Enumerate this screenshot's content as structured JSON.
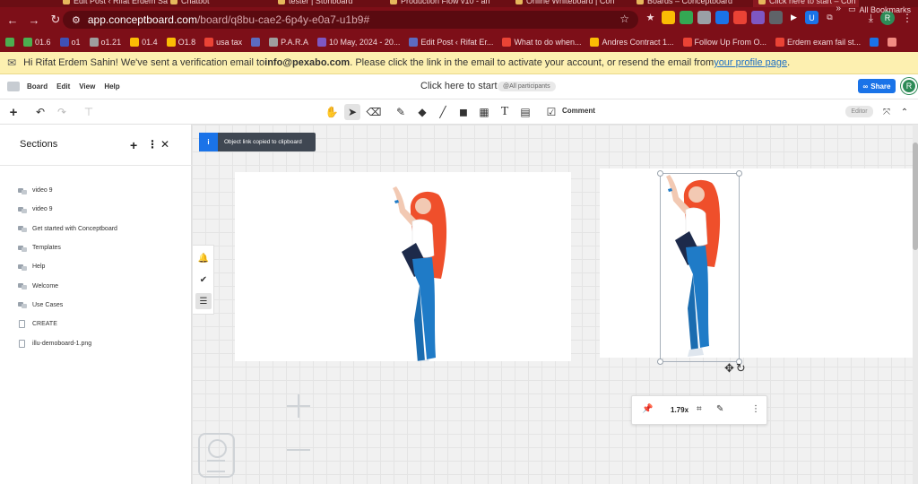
{
  "browser": {
    "tabs": [
      {
        "label": "Edit Post ‹ Rifat Erdem Sa",
        "active": false
      },
      {
        "label": "Chatbot",
        "active": false
      },
      {
        "label": "tester | Storiboard",
        "active": false
      },
      {
        "label": "Production Flow v10 - an",
        "active": false
      },
      {
        "label": "Online Whiteboard | Con",
        "active": false
      },
      {
        "label": "Boards – Conceptboard",
        "active": false
      },
      {
        "label": "Click here to start – Con",
        "active": true
      }
    ],
    "url_host": "app.conceptboard.com",
    "url_path": "/board/q8bu-cae2-6p4y-e0a7-u1b9#",
    "profile_initial": "R",
    "bookmarks": [
      {
        "label": "",
        "color": "#4caf50"
      },
      {
        "label": "01.6",
        "color": "#4caf50"
      },
      {
        "label": "o1",
        "color": "#3f51b5"
      },
      {
        "label": "o1.21",
        "color": "#9e9e9e"
      },
      {
        "label": "01.4",
        "color": "#fbbc04"
      },
      {
        "label": "O1.8",
        "color": "#fbbc04"
      },
      {
        "label": "usa tax",
        "color": "#ea4335"
      },
      {
        "label": "",
        "color": "#5c6bc0"
      },
      {
        "label": "P.A.R.A",
        "color": "#9e9e9e"
      },
      {
        "label": "10 May, 2024 - 20...",
        "color": "#7e57c2"
      },
      {
        "label": "Edit Post ‹ Rifat Er...",
        "color": "#5c6bc0"
      },
      {
        "label": "What to do when...",
        "color": "#ea4335"
      },
      {
        "label": "Andres Contract 1...",
        "color": "#fbbc04"
      },
      {
        "label": "Follow Up From O...",
        "color": "#ea4335"
      },
      {
        "label": "Erdem exam fail st...",
        "color": "#ea4335"
      },
      {
        "label": "",
        "color": "#1a73e8"
      },
      {
        "label": "",
        "color": "#f28b82"
      }
    ],
    "all_bookmarks": "All Bookmarks"
  },
  "notice": {
    "prefix": "Hi Rifat Erdem Sahin! We've sent a verification email to ",
    "email": "info@pexabo.com",
    "middle": ". Please click the link in the email to activate your account, or resend the email from ",
    "link": "your profile page",
    "suffix": "."
  },
  "header": {
    "menus": [
      "Board",
      "Edit",
      "View",
      "Help"
    ],
    "title": "Click here to start",
    "participants": "@All participants",
    "share_label": "Share",
    "user_initial": "R"
  },
  "toolbar": {
    "comment_label": "Comment",
    "mode_badge": "Editor"
  },
  "sidebar": {
    "title": "Sections",
    "sections": [
      {
        "label": "video 9",
        "icon": "board-icon"
      },
      {
        "label": "video 9",
        "icon": "board-icon"
      },
      {
        "label": "Get started with Conceptboard",
        "icon": "board-icon"
      },
      {
        "label": "Templates",
        "icon": "board-icon"
      },
      {
        "label": "Help",
        "icon": "board-icon"
      },
      {
        "label": "Welcome",
        "icon": "board-icon"
      },
      {
        "label": "Use Cases",
        "icon": "board-icon"
      },
      {
        "label": "CREATE",
        "icon": "document-icon"
      },
      {
        "label": "illu-demoboard-1.png",
        "icon": "document-icon"
      }
    ]
  },
  "canvas": {
    "toast": "Object link copied to clipboard",
    "image_zoom": "1.79x"
  },
  "colors": {
    "chrome": "#7d0f18",
    "accent": "#1a73e8",
    "notice": "#fdf0b0",
    "hair": "#ef4f2b",
    "pants": "#1f7bc7"
  }
}
